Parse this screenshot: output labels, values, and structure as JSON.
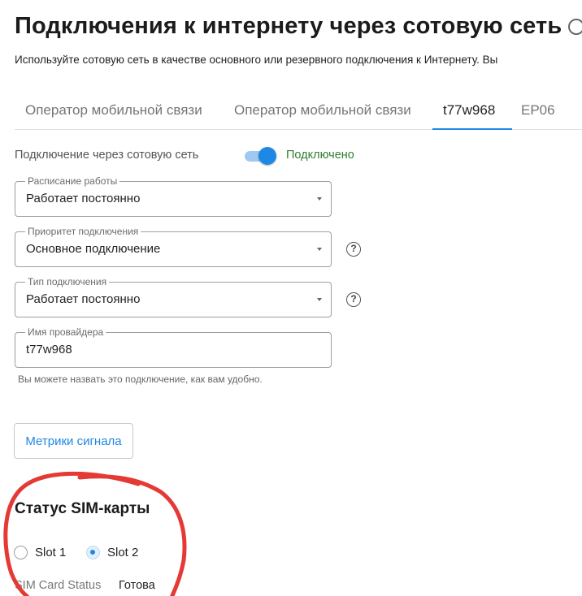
{
  "header": {
    "title": "Подключения к интернету через сотовую сеть",
    "description": "Используйте сотовую сеть в качестве основного или резервного подключения к Интернету. Вы"
  },
  "tabs": [
    {
      "label": "Оператор мобильной связи",
      "active": false
    },
    {
      "label": "Оператор мобильной связи",
      "active": false
    },
    {
      "label": "t77w968",
      "active": true
    },
    {
      "label": "EP06",
      "active": false
    }
  ],
  "connection": {
    "label": "Подключение через сотовую сеть",
    "status": "Подключено",
    "enabled": true
  },
  "fields": {
    "schedule": {
      "label": "Расписание работы",
      "value": "Работает постоянно"
    },
    "priority": {
      "label": "Приоритет подключения",
      "value": "Основное подключение"
    },
    "type": {
      "label": "Тип подключения",
      "value": "Работает постоянно"
    },
    "provider": {
      "label": "Имя провайдера",
      "value": "t77w968",
      "hint": "Вы можете назвать это подключение, как вам удобно."
    }
  },
  "metrics_button": "Метрики сигнала",
  "sim": {
    "heading": "Статус SIM-карты",
    "slots": [
      {
        "label": "Slot 1",
        "checked": false
      },
      {
        "label": "Slot 2",
        "checked": true
      }
    ],
    "status_label": "SIM Card Status",
    "status_value": "Готова"
  },
  "colors": {
    "accent": "#1e88e5",
    "connected": "#2e7d32",
    "annotation": "#e53935"
  },
  "icons": {
    "help": "help-circle-icon",
    "dropdown": "caret-down-icon"
  }
}
